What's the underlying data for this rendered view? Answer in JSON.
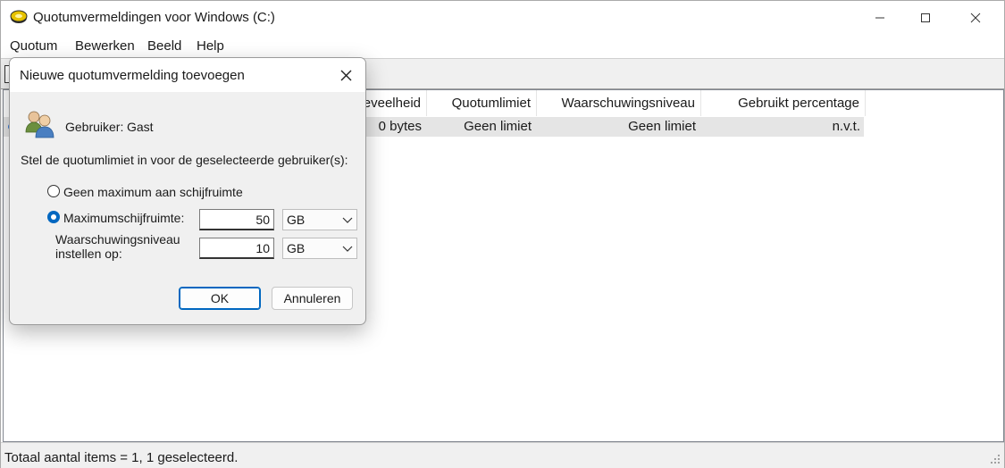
{
  "window": {
    "title": "Quotumvermeldingen voor Windows (C:)",
    "icon": "disk-icon",
    "controls": {
      "minimize": "minimize-icon",
      "maximize": "maximize-icon",
      "close": "close-icon"
    }
  },
  "menu": [
    "Quotum",
    "Bewerken",
    "Beeld",
    "Help"
  ],
  "list": {
    "columns": [
      "eveelheid",
      "Quotumlimiet",
      "Waarschuwingsniveau",
      "Gebruikt percentage"
    ],
    "rows": [
      {
        "used": "0 bytes",
        "limit": "Geen limiet",
        "warning": "Geen limiet",
        "percent": "n.v.t."
      }
    ]
  },
  "status": {
    "text": "Totaal aantal items = 1, 1 geselecteerd."
  },
  "dialog": {
    "title": "Nieuwe quotumvermelding toevoegen",
    "user_label": "Gebruiker:",
    "user_value": "Gast",
    "instruction": "Stel de quotumlimiet in voor de geselecteerde gebruiker(s):",
    "option_none": "Geen maximum aan schijfruimte",
    "option_max": "Maximumschijfruimte:",
    "selected_option": "Maximumschijfruimte:",
    "max_value": "50",
    "max_unit": "GB",
    "warn_label_line1": "Waarschuwingsniveau",
    "warn_label_line2": "instellen op:",
    "warn_value": "10",
    "warn_unit": "GB",
    "ok": "OK",
    "cancel": "Annuleren"
  },
  "colors": {
    "accent": "#0067c0",
    "selected_row": "#e5e5e5"
  }
}
